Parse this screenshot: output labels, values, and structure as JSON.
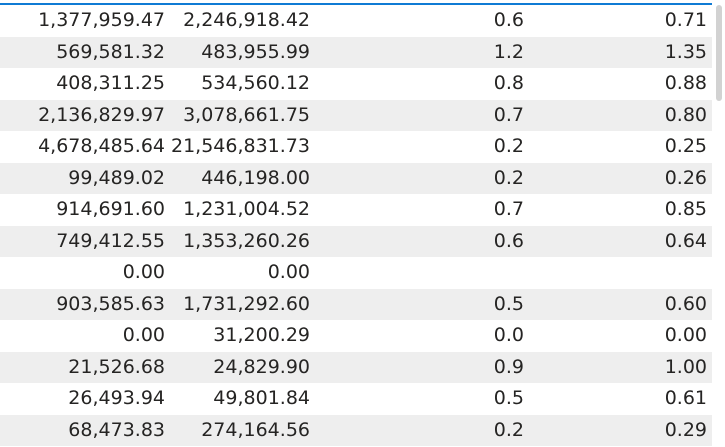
{
  "table": {
    "rows": [
      [
        "1,377,959.47",
        "2,246,918.42",
        "0.6",
        "0.71"
      ],
      [
        "569,581.32",
        "483,955.99",
        "1.2",
        "1.35"
      ],
      [
        "408,311.25",
        "534,560.12",
        "0.8",
        "0.88"
      ],
      [
        "2,136,829.97",
        "3,078,661.75",
        "0.7",
        "0.80"
      ],
      [
        "4,678,485.64",
        "21,546,831.73",
        "0.2",
        "0.25"
      ],
      [
        "99,489.02",
        "446,198.00",
        "0.2",
        "0.26"
      ],
      [
        "914,691.60",
        "1,231,004.52",
        "0.7",
        "0.85"
      ],
      [
        "749,412.55",
        "1,353,260.26",
        "0.6",
        "0.64"
      ],
      [
        "0.00",
        "0.00",
        "",
        ""
      ],
      [
        "903,585.63",
        "1,731,292.60",
        "0.5",
        "0.60"
      ],
      [
        "0.00",
        "31,200.29",
        "0.0",
        "0.00"
      ],
      [
        "21,526.68",
        "24,829.90",
        "0.9",
        "1.00"
      ],
      [
        "26,493.94",
        "49,801.84",
        "0.5",
        "0.61"
      ],
      [
        "68,473.83",
        "274,164.56",
        "0.2",
        "0.29"
      ]
    ]
  },
  "colors": {
    "accent": "#0f7bd4",
    "row_alt": "#eeeeee",
    "text": "#252423"
  },
  "scrollbar": {
    "position_fraction": 0.0
  }
}
